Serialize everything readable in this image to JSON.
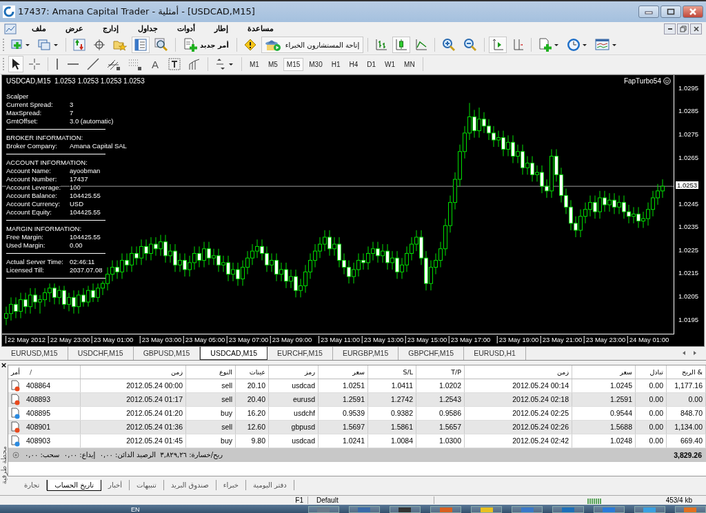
{
  "window": {
    "title": "17437: Amana Capital Trader - أمثلية - [USDCAD,M15]"
  },
  "menu": [
    "مساعدة",
    "إطار",
    "أدوات",
    "جداول",
    "إدارج",
    "عرض",
    "ملف"
  ],
  "toolbar": {
    "new_order": "أمر جديد",
    "expert_advisors": "إتاحة المستشارون الخبراء",
    "chart_types": [
      {
        "kind": "bars",
        "selected": false
      },
      {
        "kind": "candles",
        "selected": true
      },
      {
        "kind": "line",
        "selected": false
      }
    ],
    "auto_scroll": true,
    "chart_shift": false
  },
  "tools": [
    {
      "kind": "cursor",
      "selected": true
    },
    {
      "kind": "crosshair",
      "selected": false
    },
    {
      "kind": "vline",
      "selected": false
    },
    {
      "kind": "hline",
      "selected": false
    },
    {
      "kind": "trendline",
      "selected": false
    },
    {
      "kind": "channel",
      "selected": false
    },
    {
      "kind": "fibo",
      "selected": false
    },
    {
      "kind": "text",
      "glyph": "A",
      "selected": false
    },
    {
      "kind": "label",
      "selected": false
    },
    {
      "kind": "fan",
      "selected": false
    }
  ],
  "timeframes": [
    {
      "label": "M1",
      "selected": false
    },
    {
      "label": "M5",
      "selected": false
    },
    {
      "label": "M15",
      "selected": true
    },
    {
      "label": "M30",
      "selected": false
    },
    {
      "label": "H1",
      "selected": false
    },
    {
      "label": "H4",
      "selected": false
    },
    {
      "label": "D1",
      "selected": false
    },
    {
      "label": "W1",
      "selected": false
    },
    {
      "label": "MN",
      "selected": false
    }
  ],
  "chart": {
    "title": "USDCAD,M15  1.0253 1.0253 1.0253 1.0253",
    "expert": "FapTurbo54",
    "info": [
      {
        "kind": "heading",
        "text": "Scalper"
      },
      {
        "kind": "field",
        "label": "Current Spread:",
        "value": "3"
      },
      {
        "kind": "field",
        "label": "MaxSpread:",
        "value": "7"
      },
      {
        "kind": "field",
        "label": "GmtOffset:",
        "value": "3.0 (automatic)"
      },
      {
        "kind": "divider"
      },
      {
        "kind": "heading",
        "text": "BROKER INFORMATION:"
      },
      {
        "kind": "field",
        "label": "Broker Company:",
        "value": "Amana Capital SAL"
      },
      {
        "kind": "divider"
      },
      {
        "kind": "heading",
        "text": "ACCOUNT INFORMATION:"
      },
      {
        "kind": "field",
        "label": "Account Name:",
        "value": "ayoobman"
      },
      {
        "kind": "field",
        "label": "Account Number:",
        "value": "17437"
      },
      {
        "kind": "field",
        "label": "Account Leverage:",
        "value": "100"
      },
      {
        "kind": "field",
        "label": "Account Balance:",
        "value": "104425.55"
      },
      {
        "kind": "field",
        "label": "Account Currency:",
        "value": "USD"
      },
      {
        "kind": "field",
        "label": "Account Equity:",
        "value": "104425.55"
      },
      {
        "kind": "divider"
      },
      {
        "kind": "heading",
        "text": "MARGIN INFORMATION:"
      },
      {
        "kind": "field",
        "label": "Free Margin:",
        "value": "104425.55"
      },
      {
        "kind": "field",
        "label": "Used Margin:",
        "value": "0.00"
      },
      {
        "kind": "divider"
      },
      {
        "kind": "field",
        "label": "Actual Server Time:",
        "value": "02:46:11"
      },
      {
        "kind": "field",
        "label": "Licensed Till:",
        "value": "2037.07.08"
      },
      {
        "kind": "divider"
      }
    ],
    "chart_data": {
      "type": "candlestick",
      "ylim": [
        1.0189,
        1.0301
      ],
      "yticks": [
        1.0295,
        1.0285,
        1.0275,
        1.0265,
        1.0245,
        1.0235,
        1.0225,
        1.0215,
        1.0205,
        1.0195
      ],
      "categories": [
        null,
        null,
        null,
        null,
        "22 May 2012",
        null,
        null,
        null,
        null,
        null,
        null,
        null,
        null,
        "22 May 23:00",
        null,
        null,
        null,
        null,
        null,
        null,
        null,
        null,
        "23 May 01:00",
        null,
        null,
        null,
        null,
        null,
        null,
        null,
        null,
        null,
        "23 May 03:00",
        null,
        null,
        null,
        null,
        null,
        null,
        null,
        null,
        "23 May 05:00",
        null,
        null,
        null,
        null,
        null,
        null,
        null,
        null,
        "23 May 07:00",
        null,
        null,
        null,
        null,
        null,
        null,
        null,
        null,
        "23 May 09:00",
        null,
        null,
        null,
        null,
        null,
        null,
        null,
        null,
        null,
        "23 May 11:00",
        null,
        null,
        null,
        null,
        null,
        null,
        null,
        null,
        "23 May 13:00",
        null,
        null,
        null,
        null,
        null,
        null,
        null,
        null,
        "23 May 15:00",
        null,
        null,
        null,
        null,
        null,
        null,
        null,
        null,
        "23 May 17:00",
        null,
        null,
        null,
        null,
        null,
        null,
        null,
        null,
        null,
        "23 May 19:00",
        null,
        null,
        null,
        null,
        null,
        null,
        null,
        null,
        "23 May 21:00",
        null,
        null,
        null,
        null,
        null,
        null,
        null,
        null,
        "23 May 23:00",
        null,
        null,
        null,
        null,
        null,
        null,
        null,
        null,
        "24 May 01:00",
        null,
        null,
        null
      ],
      "ref_lines": [
        {
          "axis": "y",
          "value": 1.0253,
          "label": "1.0253"
        }
      ],
      "ohlc": [
        [
          1.0196,
          1.0201,
          1.0193,
          1.0198
        ],
        [
          1.0198,
          1.0205,
          1.0195,
          1.0202
        ],
        [
          1.0202,
          1.0205,
          1.0196,
          1.0199
        ],
        [
          1.0199,
          1.0207,
          1.0196,
          1.0204
        ],
        [
          1.0204,
          1.0207,
          1.0198,
          1.0201
        ],
        [
          1.0201,
          1.0209,
          1.0198,
          1.0206
        ],
        [
          1.0206,
          1.0209,
          1.02,
          1.0203
        ],
        [
          1.0203,
          1.0206,
          1.0198,
          1.0204
        ],
        [
          1.0204,
          1.0209,
          1.0201,
          1.0207
        ],
        [
          1.0207,
          1.0211,
          1.0203,
          1.0209
        ],
        [
          1.0209,
          1.0211,
          1.0202,
          1.0205
        ],
        [
          1.0205,
          1.021,
          1.0202,
          1.0208
        ],
        [
          1.0208,
          1.021,
          1.02,
          1.0202
        ],
        [
          1.0202,
          1.0207,
          1.0199,
          1.0205
        ],
        [
          1.0205,
          1.0208,
          1.0198,
          1.0201
        ],
        [
          1.0201,
          1.0208,
          1.0198,
          1.0206
        ],
        [
          1.0206,
          1.0209,
          1.0201,
          1.0203
        ],
        [
          1.0203,
          1.021,
          1.0201,
          1.0208
        ],
        [
          1.0208,
          1.0211,
          1.0203,
          1.0205
        ],
        [
          1.0205,
          1.0211,
          1.0203,
          1.0209
        ],
        [
          1.0209,
          1.0212,
          1.0206,
          1.0211
        ],
        [
          1.0211,
          1.0218,
          1.0208,
          1.0215
        ],
        [
          1.0215,
          1.0221,
          1.0212,
          1.0218
        ],
        [
          1.0218,
          1.0221,
          1.0213,
          1.0216
        ],
        [
          1.0216,
          1.0224,
          1.0213,
          1.0221
        ],
        [
          1.0221,
          1.0224,
          1.0216,
          1.0219
        ],
        [
          1.0219,
          1.0227,
          1.0216,
          1.0224
        ],
        [
          1.0224,
          1.0227,
          1.0219,
          1.0222
        ],
        [
          1.0222,
          1.023,
          1.0219,
          1.0227
        ],
        [
          1.0227,
          1.023,
          1.0221,
          1.0224
        ],
        [
          1.0224,
          1.0231,
          1.0221,
          1.0228
        ],
        [
          1.0228,
          1.0231,
          1.0223,
          1.0226
        ],
        [
          1.0226,
          1.0232,
          1.0223,
          1.0229
        ],
        [
          1.0229,
          1.0232,
          1.022,
          1.0223
        ],
        [
          1.0223,
          1.0228,
          1.022,
          1.0225
        ],
        [
          1.0225,
          1.0228,
          1.0216,
          1.0219
        ],
        [
          1.0219,
          1.0224,
          1.0216,
          1.0221
        ],
        [
          1.0221,
          1.0224,
          1.0214,
          1.0217
        ],
        [
          1.0217,
          1.0223,
          1.0214,
          1.022
        ],
        [
          1.022,
          1.0227,
          1.0217,
          1.0224
        ],
        [
          1.0224,
          1.0227,
          1.0218,
          1.0221
        ],
        [
          1.0221,
          1.0229,
          1.0218,
          1.0226
        ],
        [
          1.0226,
          1.0229,
          1.0219,
          1.0222
        ],
        [
          1.0222,
          1.0226,
          1.0219,
          1.0223
        ],
        [
          1.0223,
          1.0226,
          1.0216,
          1.0219
        ],
        [
          1.0219,
          1.0223,
          1.0216,
          1.022
        ],
        [
          1.022,
          1.0223,
          1.0212,
          1.0215
        ],
        [
          1.0215,
          1.022,
          1.0212,
          1.0217
        ],
        [
          1.0217,
          1.022,
          1.021,
          1.0213
        ],
        [
          1.0213,
          1.0221,
          1.021,
          1.0218
        ],
        [
          1.0218,
          1.0225,
          1.0215,
          1.0222
        ],
        [
          1.0222,
          1.0228,
          1.0219,
          1.0225
        ],
        [
          1.0225,
          1.023,
          1.0222,
          1.0227
        ],
        [
          1.0227,
          1.023,
          1.0221,
          1.0224
        ],
        [
          1.0224,
          1.0227,
          1.0216,
          1.0219
        ],
        [
          1.0219,
          1.0224,
          1.0216,
          1.0221
        ],
        [
          1.0221,
          1.0224,
          1.0212,
          1.0215
        ],
        [
          1.0215,
          1.022,
          1.0212,
          1.0217
        ],
        [
          1.0217,
          1.022,
          1.0209,
          1.0212
        ],
        [
          1.0212,
          1.0217,
          1.0209,
          1.0214
        ],
        [
          1.0214,
          1.0217,
          1.0205,
          1.0208
        ],
        [
          1.0208,
          1.0213,
          1.0205,
          1.021
        ],
        [
          1.021,
          1.0219,
          1.0207,
          1.0216
        ],
        [
          1.0216,
          1.0224,
          1.0213,
          1.0221
        ],
        [
          1.0221,
          1.0228,
          1.0218,
          1.0225
        ],
        [
          1.0225,
          1.0231,
          1.0222,
          1.0228
        ],
        [
          1.0228,
          1.0234,
          1.0225,
          1.0231
        ],
        [
          1.0231,
          1.0234,
          1.0223,
          1.0226
        ],
        [
          1.0226,
          1.0231,
          1.0223,
          1.0228
        ],
        [
          1.0228,
          1.0231,
          1.0218,
          1.0221
        ],
        [
          1.0221,
          1.0224,
          1.0215,
          1.0218
        ],
        [
          1.0218,
          1.0221,
          1.0211,
          1.0214
        ],
        [
          1.0214,
          1.022,
          1.0211,
          1.0217
        ],
        [
          1.0217,
          1.0224,
          1.0214,
          1.0221
        ],
        [
          1.0221,
          1.0224,
          1.0217,
          1.022
        ],
        [
          1.022,
          1.0227,
          1.0217,
          1.0224
        ],
        [
          1.0224,
          1.0229,
          1.0221,
          1.0226
        ],
        [
          1.0226,
          1.0229,
          1.022,
          1.0223
        ],
        [
          1.0223,
          1.0228,
          1.022,
          1.0225
        ],
        [
          1.0225,
          1.0228,
          1.0217,
          1.022
        ],
        [
          1.022,
          1.0225,
          1.0217,
          1.0222
        ],
        [
          1.0222,
          1.0225,
          1.0213,
          1.0216
        ],
        [
          1.0216,
          1.0222,
          1.0213,
          1.0219
        ],
        [
          1.0219,
          1.0227,
          1.0216,
          1.0224
        ],
        [
          1.0224,
          1.0231,
          1.0221,
          1.0228
        ],
        [
          1.0228,
          1.0234,
          1.0225,
          1.0231
        ],
        [
          1.0231,
          1.0234,
          1.0219,
          1.0222
        ],
        [
          1.0222,
          1.0225,
          1.0208,
          1.0211
        ],
        [
          1.0211,
          1.0221,
          1.0208,
          1.0218
        ],
        [
          1.0218,
          1.0224,
          1.0215,
          1.0221
        ],
        [
          1.0221,
          1.0229,
          1.0218,
          1.0226
        ],
        [
          1.0226,
          1.0239,
          1.0223,
          1.0236
        ],
        [
          1.0236,
          1.0249,
          1.0233,
          1.0246
        ],
        [
          1.0246,
          1.0259,
          1.0243,
          1.0256
        ],
        [
          1.0256,
          1.0271,
          1.0253,
          1.0268
        ],
        [
          1.0268,
          1.0279,
          1.0265,
          1.0276
        ],
        [
          1.0276,
          1.0289,
          1.0273,
          1.0283
        ],
        [
          1.0283,
          1.0286,
          1.0274,
          1.0277
        ],
        [
          1.0277,
          1.0287,
          1.0274,
          1.0282
        ],
        [
          1.0282,
          1.0285,
          1.0276,
          1.0279
        ],
        [
          1.0279,
          1.0282,
          1.0273,
          1.0276
        ],
        [
          1.0276,
          1.0279,
          1.027,
          1.0273
        ],
        [
          1.0273,
          1.0277,
          1.027,
          1.0274
        ],
        [
          1.0274,
          1.0277,
          1.0266,
          1.0269
        ],
        [
          1.0269,
          1.0275,
          1.0266,
          1.0272
        ],
        [
          1.0272,
          1.0275,
          1.0263,
          1.0266
        ],
        [
          1.0266,
          1.0271,
          1.0263,
          1.0268
        ],
        [
          1.0268,
          1.0271,
          1.0258,
          1.0261
        ],
        [
          1.0261,
          1.0266,
          1.0258,
          1.0263
        ],
        [
          1.0263,
          1.0266,
          1.0255,
          1.0258
        ],
        [
          1.0258,
          1.0262,
          1.0255,
          1.0259
        ],
        [
          1.0259,
          1.0262,
          1.025,
          1.0253
        ],
        [
          1.0253,
          1.0256,
          1.0248,
          1.0251
        ],
        [
          1.0251,
          1.0269,
          1.0248,
          1.0266
        ],
        [
          1.0266,
          1.0269,
          1.0255,
          1.0258
        ],
        [
          1.0258,
          1.0261,
          1.0246,
          1.0249
        ],
        [
          1.0249,
          1.0252,
          1.0241,
          1.0244
        ],
        [
          1.0244,
          1.0247,
          1.0234,
          1.0237
        ],
        [
          1.0237,
          1.024,
          1.0231,
          1.0234
        ],
        [
          1.0234,
          1.0243,
          1.0231,
          1.024
        ],
        [
          1.024,
          1.0246,
          1.0237,
          1.0243
        ],
        [
          1.0243,
          1.0249,
          1.024,
          1.0246
        ],
        [
          1.0246,
          1.0249,
          1.0239,
          1.0242
        ],
        [
          1.0242,
          1.0251,
          1.0239,
          1.0248
        ],
        [
          1.0248,
          1.0251,
          1.0242,
          1.0245
        ],
        [
          1.0245,
          1.025,
          1.0242,
          1.0247
        ],
        [
          1.0247,
          1.025,
          1.0241,
          1.0244
        ],
        [
          1.0244,
          1.0249,
          1.0241,
          1.0246
        ],
        [
          1.0246,
          1.0249,
          1.0239,
          1.0242
        ],
        [
          1.0242,
          1.0245,
          1.0237,
          1.024
        ],
        [
          1.024,
          1.0244,
          1.0237,
          1.0241
        ],
        [
          1.0241,
          1.0244,
          1.0235,
          1.0238
        ],
        [
          1.0238,
          1.0242,
          1.0235,
          1.0239
        ],
        [
          1.0239,
          1.0246,
          1.0236,
          1.0243
        ],
        [
          1.0243,
          1.0251,
          1.024,
          1.0248
        ],
        [
          1.0248,
          1.0254,
          1.0245,
          1.0251
        ],
        [
          1.0251,
          1.0256,
          1.0248,
          1.0253
        ]
      ]
    }
  },
  "chart_tabs": [
    {
      "label": "EURUSD,M15",
      "selected": false
    },
    {
      "label": "USDCHF,M15",
      "selected": false
    },
    {
      "label": "GBPUSD,M15",
      "selected": false
    },
    {
      "label": "USDCAD,M15",
      "selected": true
    },
    {
      "label": "EURCHF,M15",
      "selected": false
    },
    {
      "label": "EURGBP,M15",
      "selected": false
    },
    {
      "label": "GBPCHF,M15",
      "selected": false
    },
    {
      "label": "EURUSD,H1",
      "selected": false
    }
  ],
  "terminal": {
    "close": "×",
    "side_label": "محطة طرفية",
    "sort_mark": "/",
    "columns": [
      "أمر",
      "زمن",
      "النوع",
      "عينات",
      "رمز",
      "سعر",
      "S/L",
      "T/P",
      "زمن",
      "سعر",
      "تبادل",
      "الربح &"
    ],
    "rows": [
      {
        "kind": "sell",
        "cells": [
          "408864",
          "2012.05.24 00:00",
          "sell",
          "20.10",
          "usdcad",
          "1.0251",
          "1.0411",
          "1.0202",
          "2012.05.24 00:14",
          "1.0245",
          "0.00",
          "1,177.16"
        ]
      },
      {
        "kind": "sell",
        "cells": [
          "408893",
          "2012.05.24 01:17",
          "sell",
          "20.40",
          "eurusd",
          "1.2591",
          "1.2742",
          "1.2543",
          "2012.05.24 02:18",
          "1.2591",
          "0.00",
          "0.00"
        ]
      },
      {
        "kind": "buy",
        "cells": [
          "408895",
          "2012.05.24 01:20",
          "buy",
          "16.20",
          "usdchf",
          "0.9539",
          "0.9382",
          "0.9586",
          "2012.05.24 02:25",
          "0.9544",
          "0.00",
          "848.70"
        ]
      },
      {
        "kind": "sell",
        "cells": [
          "408901",
          "2012.05.24 01:36",
          "sell",
          "12.60",
          "gbpusd",
          "1.5697",
          "1.5861",
          "1.5657",
          "2012.05.24 02:26",
          "1.5688",
          "0.00",
          "1,134.00"
        ]
      },
      {
        "kind": "buy",
        "cells": [
          "408903",
          "2012.05.24 01:45",
          "buy",
          "9.80",
          "usdcad",
          "1.0241",
          "1.0084",
          "1.0300",
          "2012.05.24 02:42",
          "1.0248",
          "0.00",
          "669.40"
        ]
      }
    ],
    "summary": "ربح/خسارة: ٣,٨٢٩,٢٦  الرصيد الدائن: ٠,٠٠  إيداع: ٠,٠٠  سحب: ٠,٠٠",
    "total": "3,829.26",
    "tabs": [
      {
        "label": "دفتر اليومية",
        "selected": false
      },
      {
        "label": "خبراء",
        "selected": false
      },
      {
        "label": "صندوق البريد",
        "selected": false
      },
      {
        "label": "تنبيهات",
        "selected": false
      },
      {
        "label": "أخبار",
        "selected": false
      },
      {
        "label": "تاريخ الحساب",
        "selected": true
      },
      {
        "label": "تجارة",
        "selected": false
      }
    ]
  },
  "status_bar": {
    "help": "F1",
    "profile": "Default",
    "traffic": "453/4 kb"
  },
  "taskbar": {
    "language": "EN"
  }
}
